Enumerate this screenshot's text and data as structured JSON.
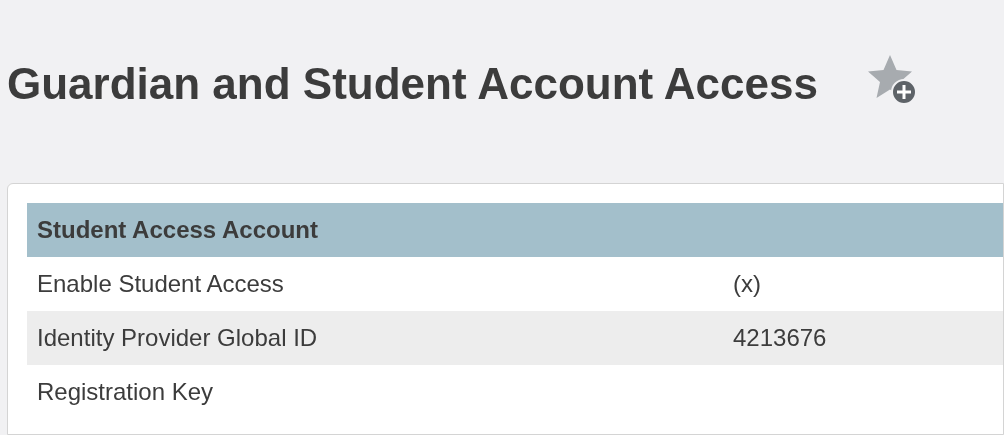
{
  "page_title": "Guardian and Student Account Access",
  "table": {
    "heading": "Student Access Account",
    "rows": [
      {
        "label": "Enable Student Access",
        "value": "(x)"
      },
      {
        "label": "Identity Provider Global ID",
        "value": "4213676"
      },
      {
        "label": "Registration Key"
      }
    ]
  }
}
